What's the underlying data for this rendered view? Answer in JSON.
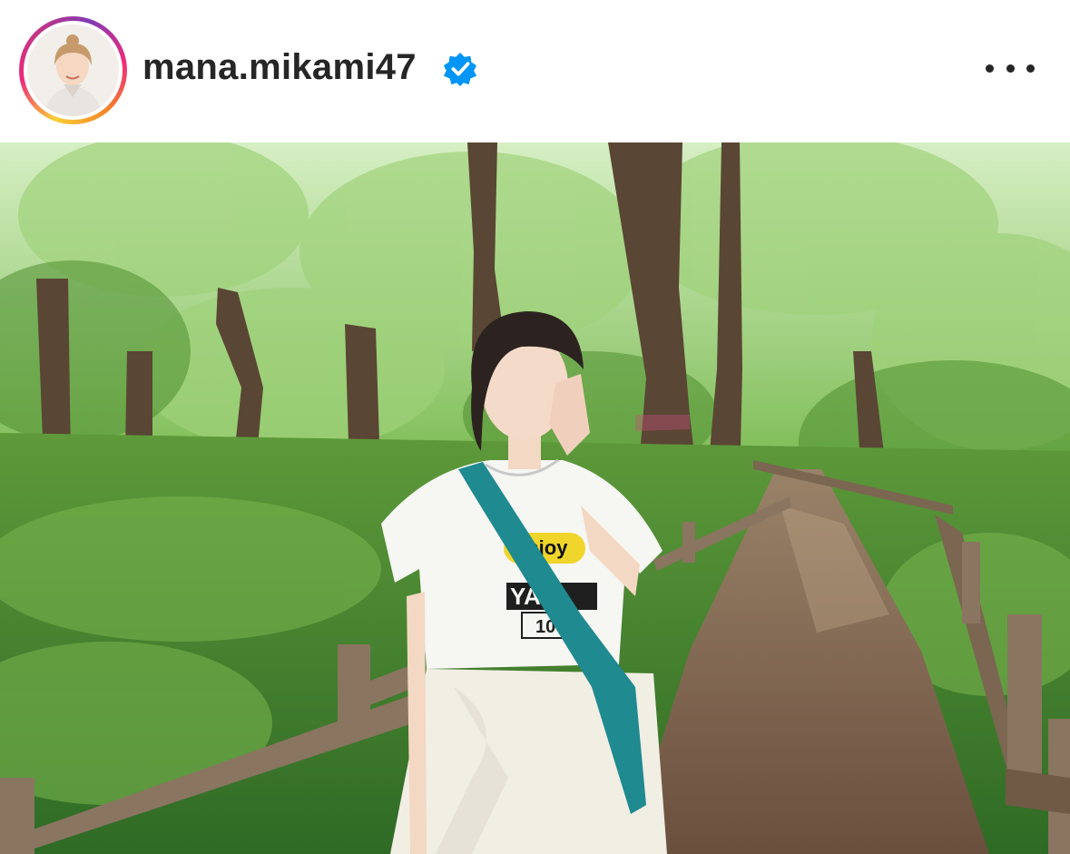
{
  "post": {
    "username": "mana.mikami47",
    "verified": true,
    "verified_badge_color": "#0095f6",
    "avatar_story_ring": true,
    "more_icon": "more-horizontal-icon"
  },
  "photo": {
    "shirt_text_top": "enjoy",
    "shirt_text_mid": "YA",
    "shirt_text_bottom": "100"
  },
  "colors": {
    "foliage": "#5f9a37",
    "path": "#7d6450",
    "text": "#262626"
  }
}
